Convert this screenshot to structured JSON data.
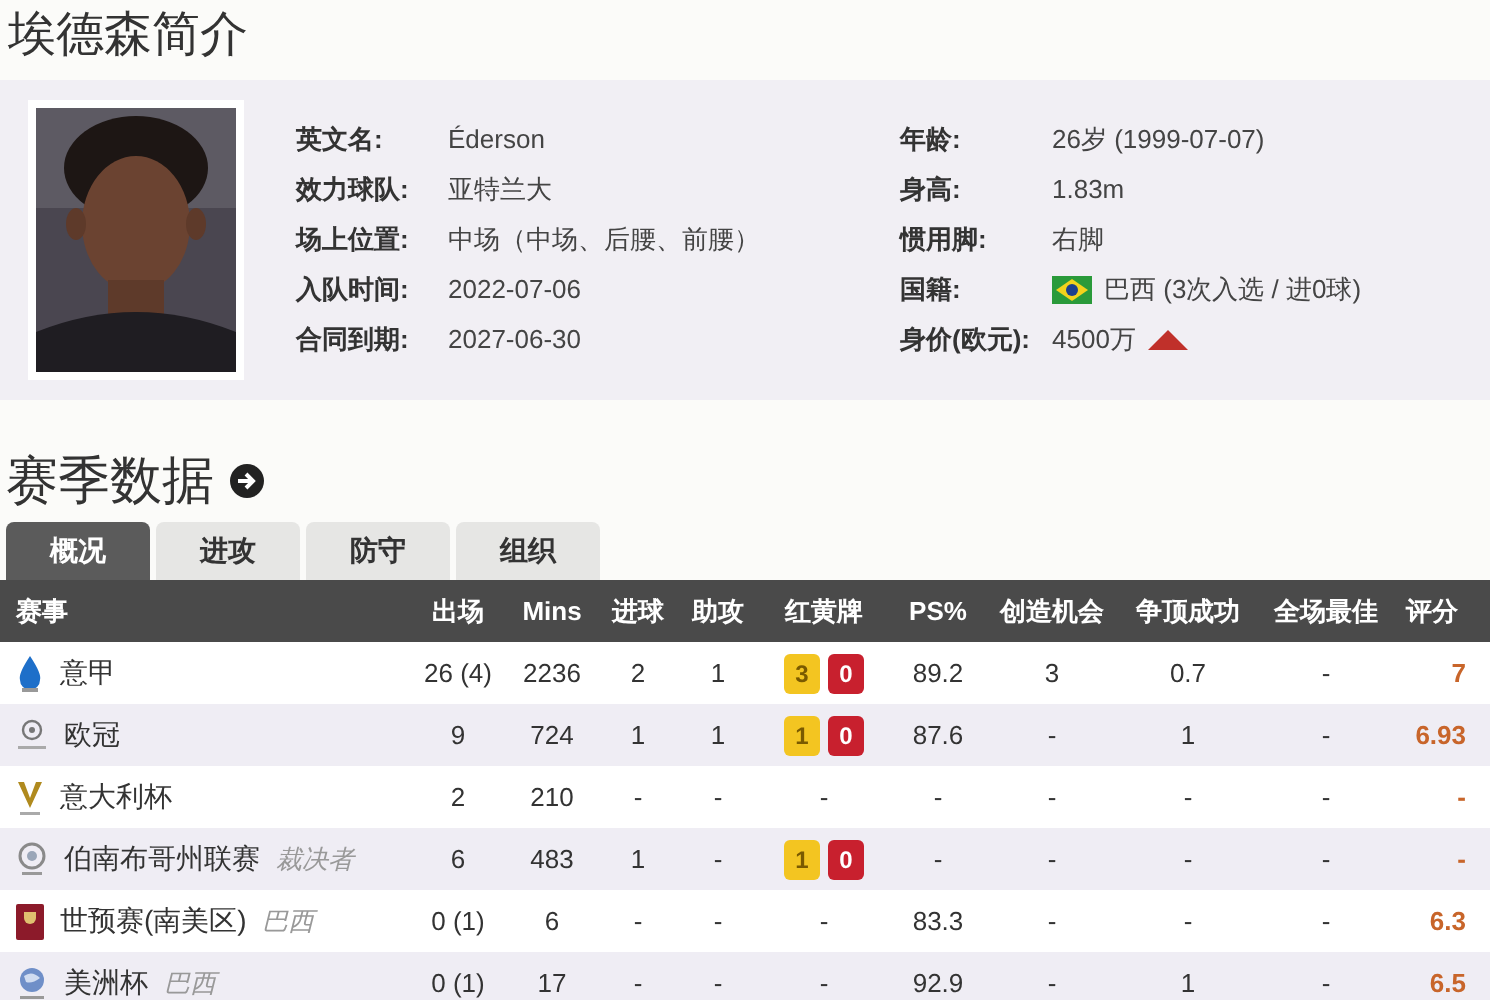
{
  "title": "埃德森简介",
  "profile": {
    "left": [
      {
        "label": "英文名:",
        "value": "Éderson"
      },
      {
        "label": "效力球队:",
        "value": "亚特兰大"
      },
      {
        "label": "场上位置:",
        "value": "中场（中场、后腰、前腰）"
      },
      {
        "label": "入队时间:",
        "value": "2022-07-06"
      },
      {
        "label": "合同到期:",
        "value": "2027-06-30"
      }
    ],
    "right": [
      {
        "label": "年龄:",
        "value": "26岁  (1999-07-07)"
      },
      {
        "label": "身高:",
        "value": "1.83m"
      },
      {
        "label": "惯用脚:",
        "value": "右脚"
      },
      {
        "label": "国籍:",
        "value": "巴西 (3次入选 / 进0球)",
        "kind": "flag"
      },
      {
        "label": "身价(欧元):",
        "value": "4500万",
        "kind": "trend"
      }
    ]
  },
  "section_title": "赛季数据",
  "tabs": [
    {
      "label": "概况",
      "selected": true
    },
    {
      "label": "进攻",
      "selected": false
    },
    {
      "label": "防守",
      "selected": false
    },
    {
      "label": "组织",
      "selected": false
    }
  ],
  "table": {
    "columns": [
      "赛事",
      "出场",
      "Mins",
      "进球",
      "助攻",
      "红黄牌",
      "PS%",
      "创造机会",
      "争顶成功",
      "全场最佳",
      "评分"
    ],
    "rows": [
      {
        "name": "意甲",
        "apps": "26 (4)",
        "mins": "2236",
        "goals": "2",
        "assists": "1",
        "cards": {
          "yellow": "3",
          "red": "0"
        },
        "ps": "89.2",
        "chances": "3",
        "aerials": "0.7",
        "motm": "-",
        "rating": "7"
      },
      {
        "name": "欧冠",
        "apps": "9",
        "mins": "724",
        "goals": "1",
        "assists": "1",
        "cards": {
          "yellow": "1",
          "red": "0"
        },
        "ps": "87.6",
        "chances": "-",
        "aerials": "1",
        "motm": "-",
        "rating": "6.93"
      },
      {
        "name": "意大利杯",
        "apps": "2",
        "mins": "210",
        "goals": "-",
        "assists": "-",
        "cards": "-",
        "ps": "-",
        "chances": "-",
        "aerials": "-",
        "motm": "-",
        "rating": "-"
      },
      {
        "name": "伯南布哥州联赛 *裁决者*",
        "apps": "6",
        "mins": "483",
        "goals": "1",
        "assists": "-",
        "cards": {
          "yellow": "1",
          "red": "0"
        },
        "ps": "-",
        "chances": "-",
        "aerials": "-",
        "motm": "-",
        "rating": "-"
      },
      {
        "name": "世预赛(南美区) *巴西*",
        "apps": "0 (1)",
        "mins": "6",
        "goals": "-",
        "assists": "-",
        "cards": "-",
        "ps": "83.3",
        "chances": "-",
        "aerials": "-",
        "motm": "-",
        "rating": "6.3"
      },
      {
        "name": "美洲杯 *巴西*",
        "apps": "0 (1)",
        "mins": "17",
        "goals": "-",
        "assists": "-",
        "cards": "-",
        "ps": "92.9",
        "chances": "-",
        "aerials": "1",
        "motm": "-",
        "rating": "6.5"
      }
    ]
  }
}
